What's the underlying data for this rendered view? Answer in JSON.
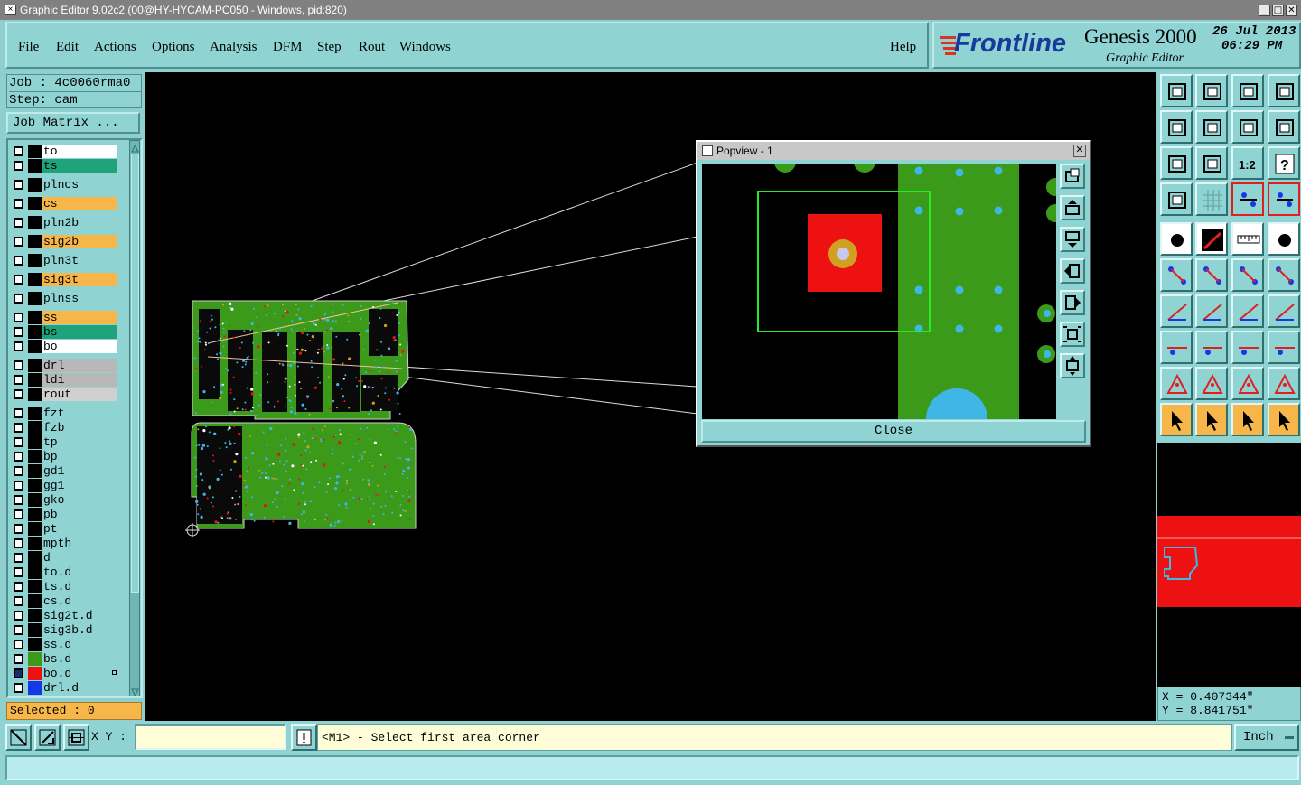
{
  "window": {
    "title": "Graphic Editor 9.02c2 (00@HY-HYCAM-PC050 - Windows, pid:820)",
    "minimize_glyph": "_",
    "maximize_glyph": "□",
    "close_glyph": "✕"
  },
  "menu": {
    "items": [
      "File",
      "Edit",
      "Actions",
      "Options",
      "Analysis",
      "DFM",
      "Step",
      "Rout",
      "Windows"
    ],
    "help": "Help"
  },
  "brand": {
    "logo": "Frontline",
    "product": "Genesis 2000",
    "subtitle": "Graphic Editor",
    "date": "26 Jul 2013",
    "time": "06:29 PM"
  },
  "job": {
    "job_line": "Job : 4c0060rma0",
    "step_line": "Step: cam",
    "matrix_button": "Job Matrix ..."
  },
  "layers": [
    {
      "name": "to",
      "bg": "#ffffff",
      "swatch": "#000000"
    },
    {
      "name": "ts",
      "bg": "#1fa37a",
      "swatch": "#000000"
    },
    {
      "name": "plncs",
      "bg": "#8fd3d3",
      "swatch": "#000000"
    },
    {
      "name": "cs",
      "bg": "#f7b64a",
      "swatch": "#000000"
    },
    {
      "name": "pln2b",
      "bg": "#8fd3d3",
      "swatch": "#000000"
    },
    {
      "name": "sig2b",
      "bg": "#f7b64a",
      "swatch": "#000000"
    },
    {
      "name": "pln3t",
      "bg": "#8fd3d3",
      "swatch": "#000000"
    },
    {
      "name": "sig3t",
      "bg": "#f7b64a",
      "swatch": "#000000"
    },
    {
      "name": "plnss",
      "bg": "#8fd3d3",
      "swatch": "#000000"
    },
    {
      "name": "ss",
      "bg": "#f7b64a",
      "swatch": "#000000"
    },
    {
      "name": "bs",
      "bg": "#1fa37a",
      "swatch": "#000000"
    },
    {
      "name": "bo",
      "bg": "#ffffff",
      "swatch": "#000000"
    },
    {
      "name": "drl",
      "bg": "#b8b8b8",
      "swatch": "#000000"
    },
    {
      "name": "ldi",
      "bg": "#b8b8b8",
      "swatch": "#000000"
    },
    {
      "name": "rout",
      "bg": "#d0d0d0",
      "swatch": "#000000"
    },
    {
      "name": "fzt",
      "bg": "#8fd3d3",
      "swatch": "#000000"
    },
    {
      "name": "fzb",
      "bg": "#8fd3d3",
      "swatch": "#000000"
    },
    {
      "name": "tp",
      "bg": "#8fd3d3",
      "swatch": "#000000"
    },
    {
      "name": "bp",
      "bg": "#8fd3d3",
      "swatch": "#000000"
    },
    {
      "name": "gd1",
      "bg": "#8fd3d3",
      "swatch": "#000000"
    },
    {
      "name": "gg1",
      "bg": "#8fd3d3",
      "swatch": "#000000"
    },
    {
      "name": "gko",
      "bg": "#8fd3d3",
      "swatch": "#000000"
    },
    {
      "name": "pb",
      "bg": "#8fd3d3",
      "swatch": "#000000"
    },
    {
      "name": "pt",
      "bg": "#8fd3d3",
      "swatch": "#000000"
    },
    {
      "name": "mpth",
      "bg": "#8fd3d3",
      "swatch": "#000000"
    },
    {
      "name": "d",
      "bg": "#8fd3d3",
      "swatch": "#000000"
    },
    {
      "name": "to.d",
      "bg": "#8fd3d3",
      "swatch": "#000000"
    },
    {
      "name": "ts.d",
      "bg": "#8fd3d3",
      "swatch": "#000000"
    },
    {
      "name": "cs.d",
      "bg": "#8fd3d3",
      "swatch": "#000000"
    },
    {
      "name": "sig2t.d",
      "bg": "#8fd3d3",
      "swatch": "#000000"
    },
    {
      "name": "sig3b.d",
      "bg": "#8fd3d3",
      "swatch": "#000000"
    },
    {
      "name": "ss.d",
      "bg": "#8fd3d3",
      "swatch": "#000000"
    },
    {
      "name": "bs.d",
      "bg": "#8fd3d3",
      "swatch": "#3c9a1a"
    },
    {
      "name": "bo.d",
      "bg": "#8fd3d3",
      "swatch": "#ee1111"
    },
    {
      "name": "drl.d",
      "bg": "#8fd3d3",
      "swatch": "#1438e6"
    }
  ],
  "selected_text": "Selected : 0",
  "popview": {
    "title": "Popview - 1",
    "close_label": "Close"
  },
  "coords": {
    "x_text": "X = 0.407344\"",
    "y_text": "Y = 8.841751\""
  },
  "bottom": {
    "xy_label": "X Y :",
    "xy_value": "",
    "message": "<M1> - Select first area corner",
    "units": "Inch"
  },
  "colors": {
    "panel": "#8fd3d3",
    "board_green": "#3c9a1a",
    "pad_red": "#ee1111",
    "via_cyan": "#3fb7e6",
    "highlight_orange": "#f7b64a"
  }
}
